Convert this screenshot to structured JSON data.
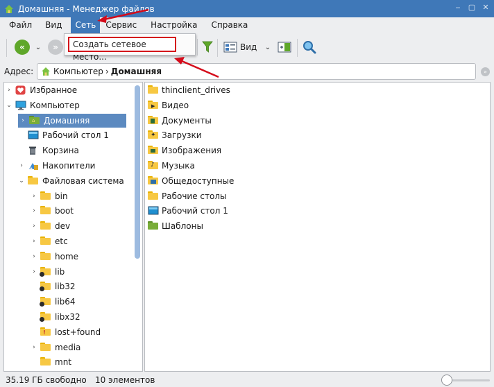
{
  "window": {
    "title": "Домашняя - Менеджер файлов",
    "controls": [
      "‒",
      "▢",
      "✕"
    ]
  },
  "menubar": {
    "items": [
      "Файл",
      "Вид",
      "Сеть",
      "Сервис",
      "Настройка",
      "Справка"
    ],
    "active_index": 2
  },
  "network_menu": {
    "items": [
      "Создать сетевое место..."
    ]
  },
  "toolbar": {
    "view_label": "Вид"
  },
  "address": {
    "label": "Адрес:",
    "crumbs": [
      "Компьютер",
      "Домашняя"
    ]
  },
  "tree": [
    {
      "label": "Избранное",
      "icon": "favorites-heart-icon",
      "expander": "›"
    },
    {
      "label": "Компьютер",
      "icon": "computer-monitor-icon",
      "expander": "⌄"
    },
    {
      "label": "Домашняя",
      "icon": "home-folder-icon",
      "expander": "›",
      "selected": true
    },
    {
      "label": "Рабочий стол 1",
      "icon": "desktop-icon",
      "expander": ""
    },
    {
      "label": "Корзина",
      "icon": "trash-icon",
      "expander": ""
    },
    {
      "label": "Накопители",
      "icon": "drives-icon",
      "expander": "›"
    },
    {
      "label": "Файловая система",
      "icon": "folder-icon",
      "expander": "⌄"
    },
    {
      "label": "bin",
      "icon": "folder-icon",
      "expander": "›"
    },
    {
      "label": "boot",
      "icon": "folder-icon",
      "expander": "›"
    },
    {
      "label": "dev",
      "icon": "folder-icon",
      "expander": "›"
    },
    {
      "label": "etc",
      "icon": "folder-icon",
      "expander": "›"
    },
    {
      "label": "home",
      "icon": "folder-icon",
      "expander": "›"
    },
    {
      "label": "lib",
      "icon": "folder-link-icon",
      "expander": "›"
    },
    {
      "label": "lib32",
      "icon": "folder-link-icon",
      "expander": ""
    },
    {
      "label": "lib64",
      "icon": "folder-link-icon",
      "expander": ""
    },
    {
      "label": "libx32",
      "icon": "folder-link-icon",
      "expander": ""
    },
    {
      "label": "lost+found",
      "icon": "folder-locked-icon",
      "expander": ""
    },
    {
      "label": "media",
      "icon": "folder-icon",
      "expander": "›"
    },
    {
      "label": "mnt",
      "icon": "folder-icon",
      "expander": ""
    }
  ],
  "files": [
    {
      "label": "thinclient_drives",
      "icon": "folder-icon"
    },
    {
      "label": "Видео",
      "icon": "videos-folder-icon"
    },
    {
      "label": "Документы",
      "icon": "documents-folder-icon"
    },
    {
      "label": "Загрузки",
      "icon": "downloads-folder-icon"
    },
    {
      "label": "Изображения",
      "icon": "pictures-folder-icon"
    },
    {
      "label": "Музыка",
      "icon": "music-folder-icon"
    },
    {
      "label": "Общедоступные",
      "icon": "public-folder-icon"
    },
    {
      "label": "Рабочие столы",
      "icon": "folder-icon"
    },
    {
      "label": "Рабочий стол 1",
      "icon": "desktop-icon"
    },
    {
      "label": "Шаблоны",
      "icon": "templates-folder-icon"
    }
  ],
  "status": {
    "free_space": "35.19 ГБ свободно",
    "count": "10 элементов"
  },
  "colors": {
    "accent": "#3f78b8",
    "annotation": "#d40b1a",
    "selection": "#5c8ac0"
  }
}
